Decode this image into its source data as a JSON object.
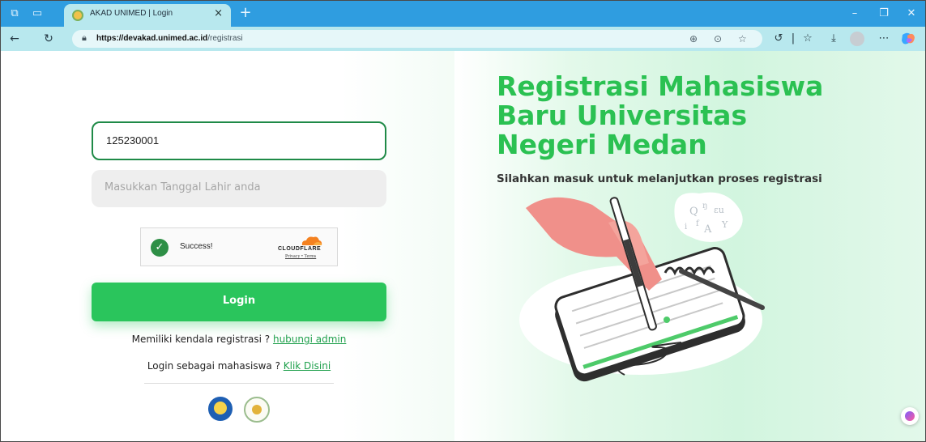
{
  "browser": {
    "tab_title": "AKAD UNIMED | Login",
    "tab_close": "×",
    "new_tab": "+",
    "url_host": "https://devakad.unimed.ac.id",
    "url_path": "/registrasi"
  },
  "form": {
    "nim_value": "125230001",
    "birthdate_placeholder": "Masukkan Tanggal Lahir anda",
    "captcha_status": "Success!",
    "captcha_brand": "CLOUDFLARE",
    "captcha_links": "Privacy • Terms",
    "login_label": "Login",
    "help_text": "Memiliki kendala registrasi ? ",
    "help_link": "hubungi admin",
    "student_text": "Login sebagai mahasiswa ? ",
    "student_link": "Klik Disini"
  },
  "hero": {
    "title_line1": "Registrasi Mahasiswa",
    "title_line2": "Baru Universitas",
    "title_line3": "Negeri Medan",
    "subtitle": "Silahkan masuk untuk melanjutkan proses registrasi"
  },
  "colors": {
    "accent": "#2bc152",
    "button": "#2ac55c",
    "titlebar": "#2f9de0",
    "toolbar": "#b8e8ee"
  },
  "icons": [
    "workspaces-icon",
    "tab-actions-icon",
    "back-icon",
    "refresh-icon",
    "lock-icon",
    "zoom-icon",
    "reading-view-icon",
    "favorite-icon",
    "refresh-sidebar-icon",
    "favorites-icon",
    "downloads-icon",
    "profile-icon",
    "more-icon",
    "copilot-icon",
    "checkmark-icon",
    "cloudflare-icon",
    "kemdikbud-logo",
    "unimed-logo"
  ]
}
